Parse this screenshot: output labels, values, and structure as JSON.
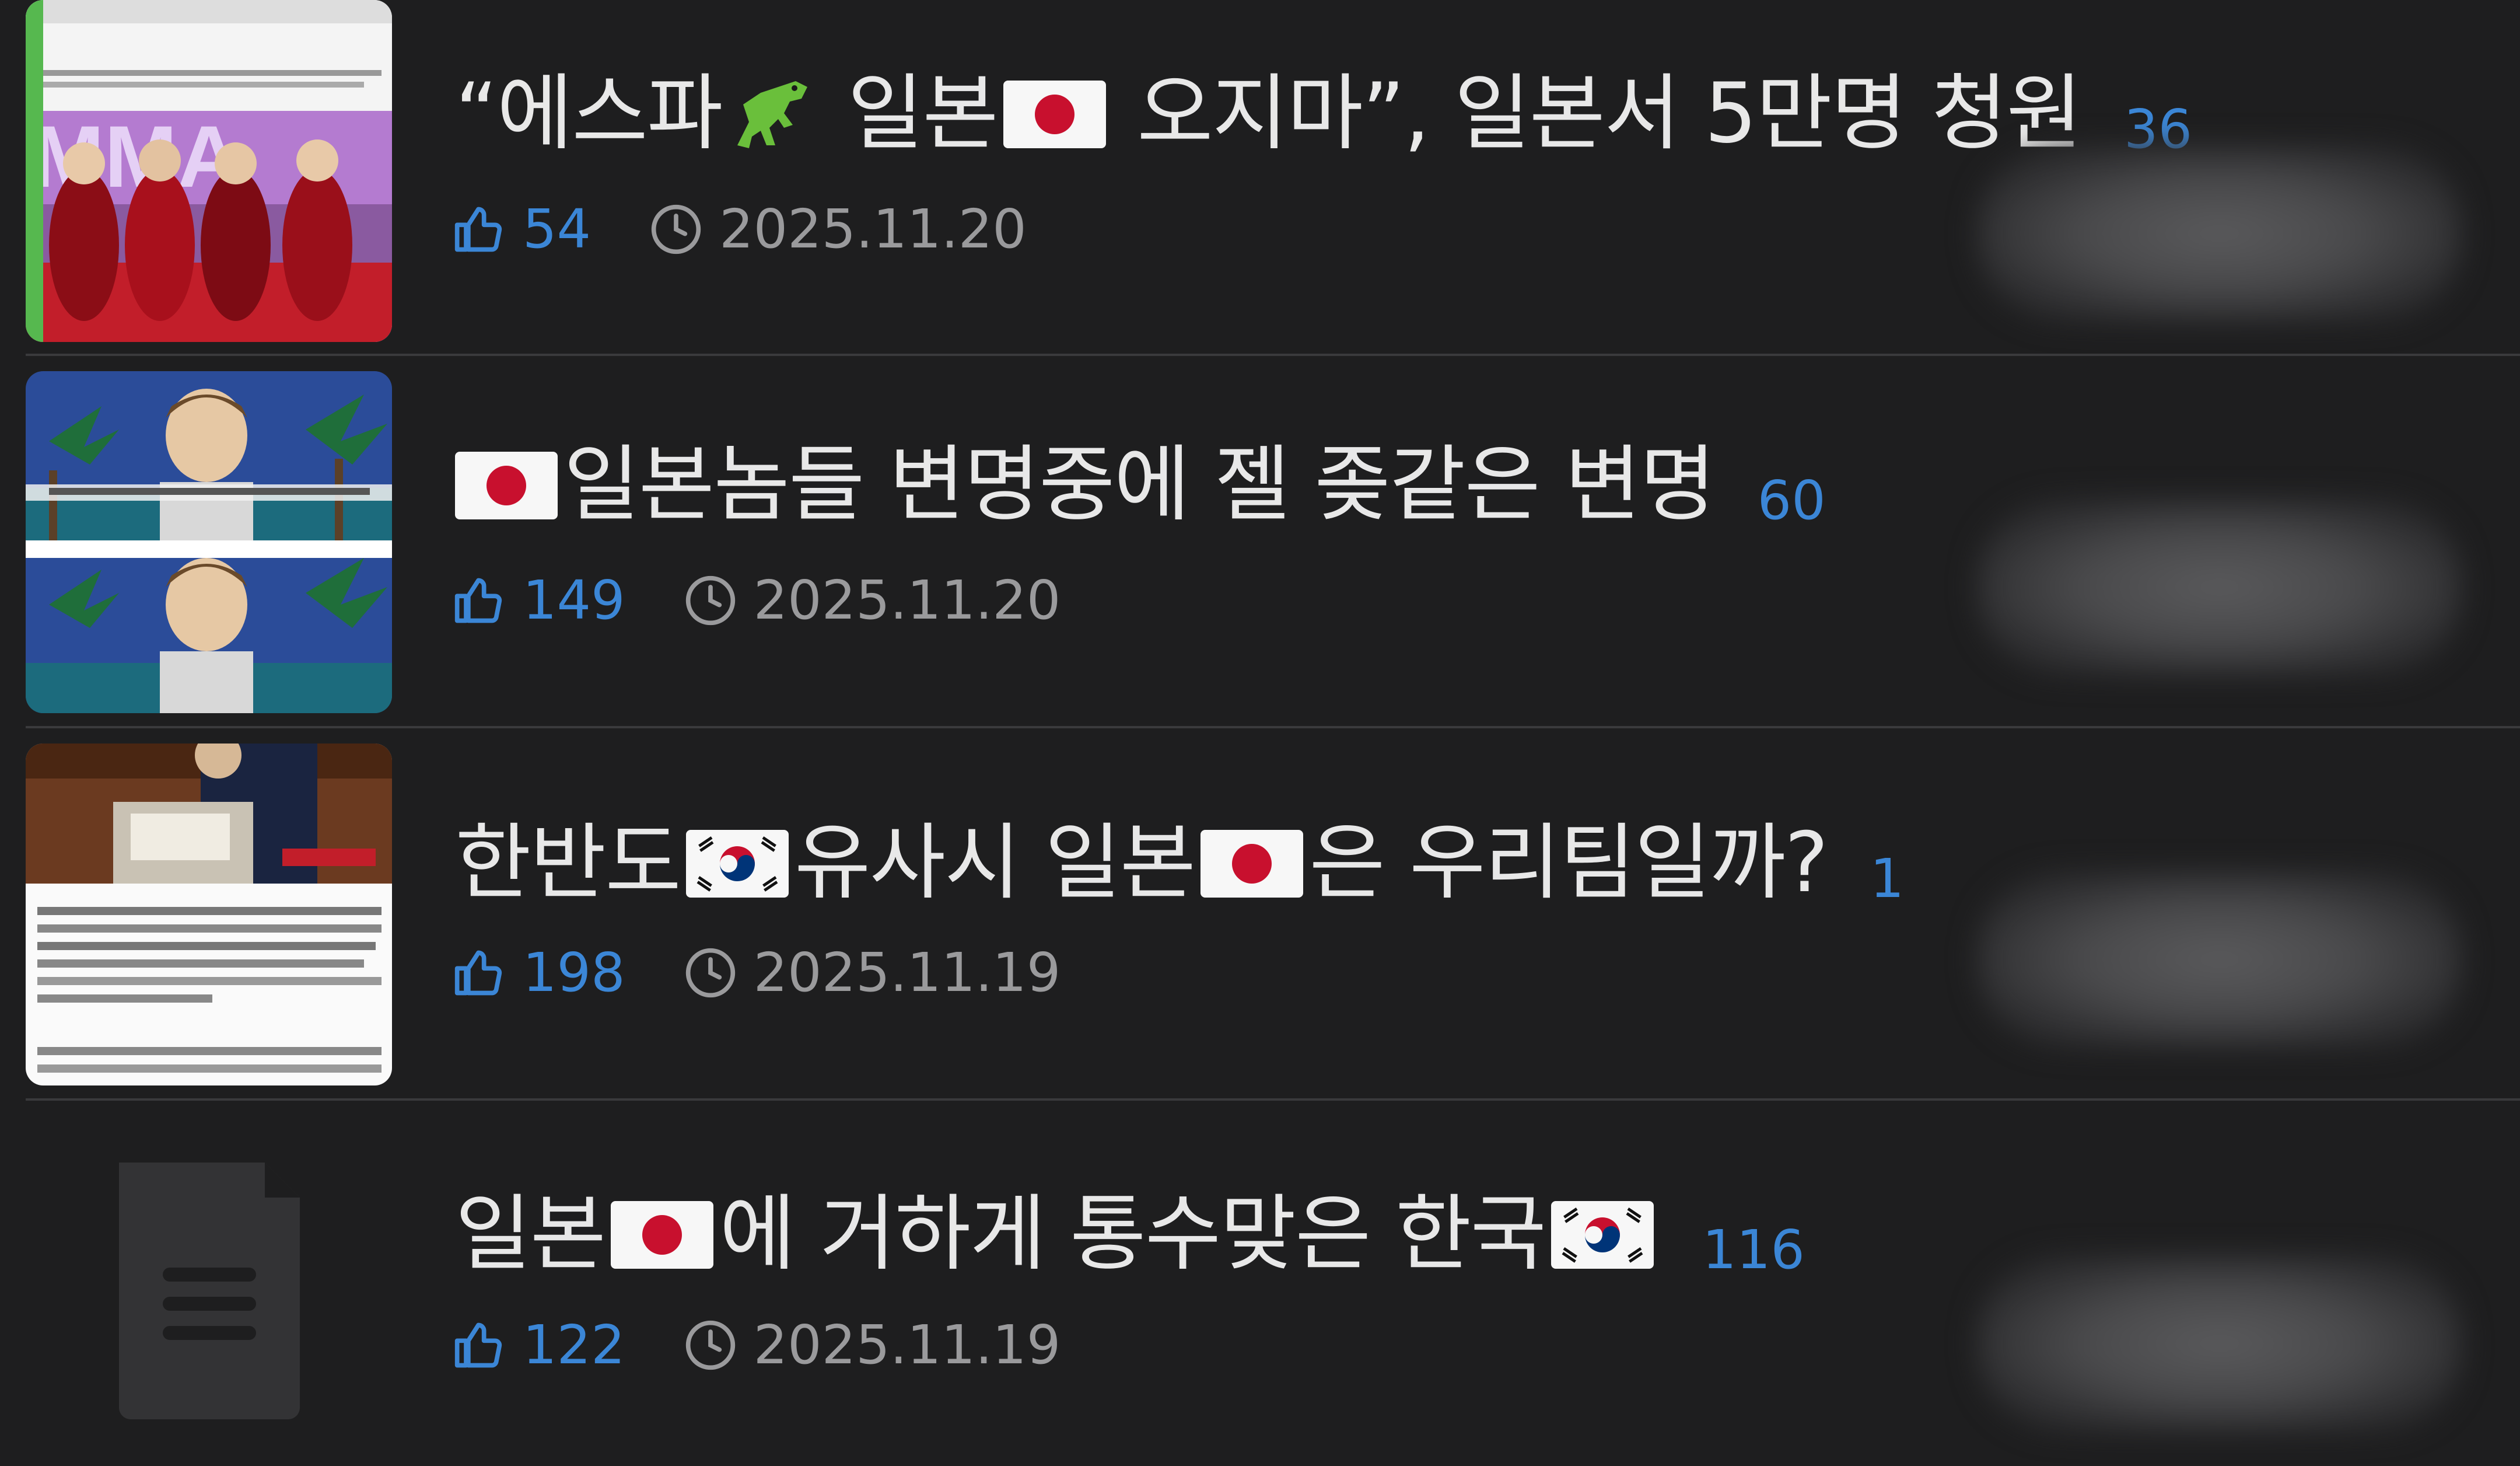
{
  "colors": {
    "background": "#1e1e1f",
    "accent": "#3b86d6",
    "date": "#9a9a9c",
    "divider": "#3a3a3c"
  },
  "posts": [
    {
      "title_parts": [
        "“에스파",
        "일본",
        "오지마”, 일본서 5만명 청원"
      ],
      "comments": "36",
      "likes": "54",
      "date": "2025.11.20"
    },
    {
      "title_parts": [
        "",
        "일본놈들 변명중에 젤 좆같은 변명"
      ],
      "comments": "60",
      "likes": "149",
      "date": "2025.11.20"
    },
    {
      "title_parts": [
        "한반도",
        "유사시 일본",
        "은 우리팀일까?"
      ],
      "comments": "1",
      "likes": "198",
      "date": "2025.11.19"
    },
    {
      "title_parts": [
        "일본",
        "에 거하게 통수맞은 한국"
      ],
      "comments": "116",
      "likes": "122",
      "date": "2025.11.19"
    }
  ],
  "icons": {
    "like": "thumbs-up-icon",
    "time": "clock-icon",
    "document": "document-icon",
    "japan_flag": "japan-flag-icon",
    "korea_flag": "korea-flag-icon",
    "dinosaur": "dinosaur-emoji"
  }
}
